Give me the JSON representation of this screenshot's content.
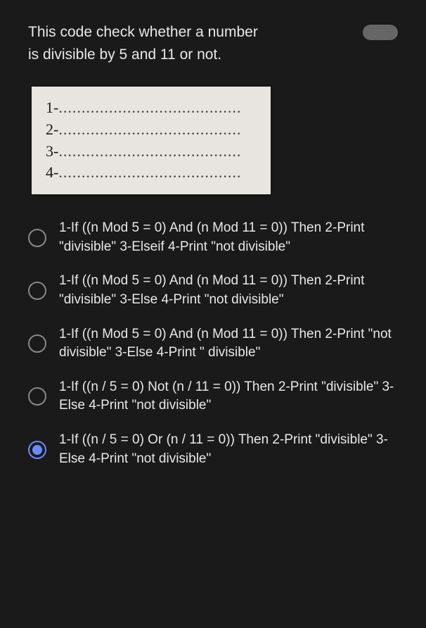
{
  "question": {
    "line1": "This code check whether a number",
    "line2": "is divisible by 5 and 11 or not."
  },
  "code_box": {
    "line1_prefix": "1-",
    "line2_prefix": "2-",
    "line3_prefix": "3-",
    "line4_prefix": "4-",
    "dots": "........................................"
  },
  "options": [
    {
      "text": "1-If ((n Mod 5 = 0) And (n Mod 11 = 0)) Then 2-Print \"divisible\" 3-Elseif 4-Print \"not divisible\"",
      "selected": false
    },
    {
      "text": "1-If ((n Mod 5 = 0) And (n Mod 11 = 0)) Then 2-Print \"divisible\" 3-Else 4-Print \"not divisible\"",
      "selected": false
    },
    {
      "text": "1-If ((n Mod 5 = 0) And (n Mod 11 = 0)) Then 2-Print \"not divisible\" 3-Else 4-Print \" divisible\"",
      "selected": false
    },
    {
      "text": "1-If ((n / 5 = 0) Not (n / 11 = 0)) Then 2-Print \"divisible\" 3-Else 4-Print \"not divisible\"",
      "selected": false
    },
    {
      "text": "1-If ((n / 5 = 0) Or (n / 11 = 0)) Then 2-Print \"divisible\" 3-Else 4-Print \"not divisible\"",
      "selected": true
    }
  ]
}
